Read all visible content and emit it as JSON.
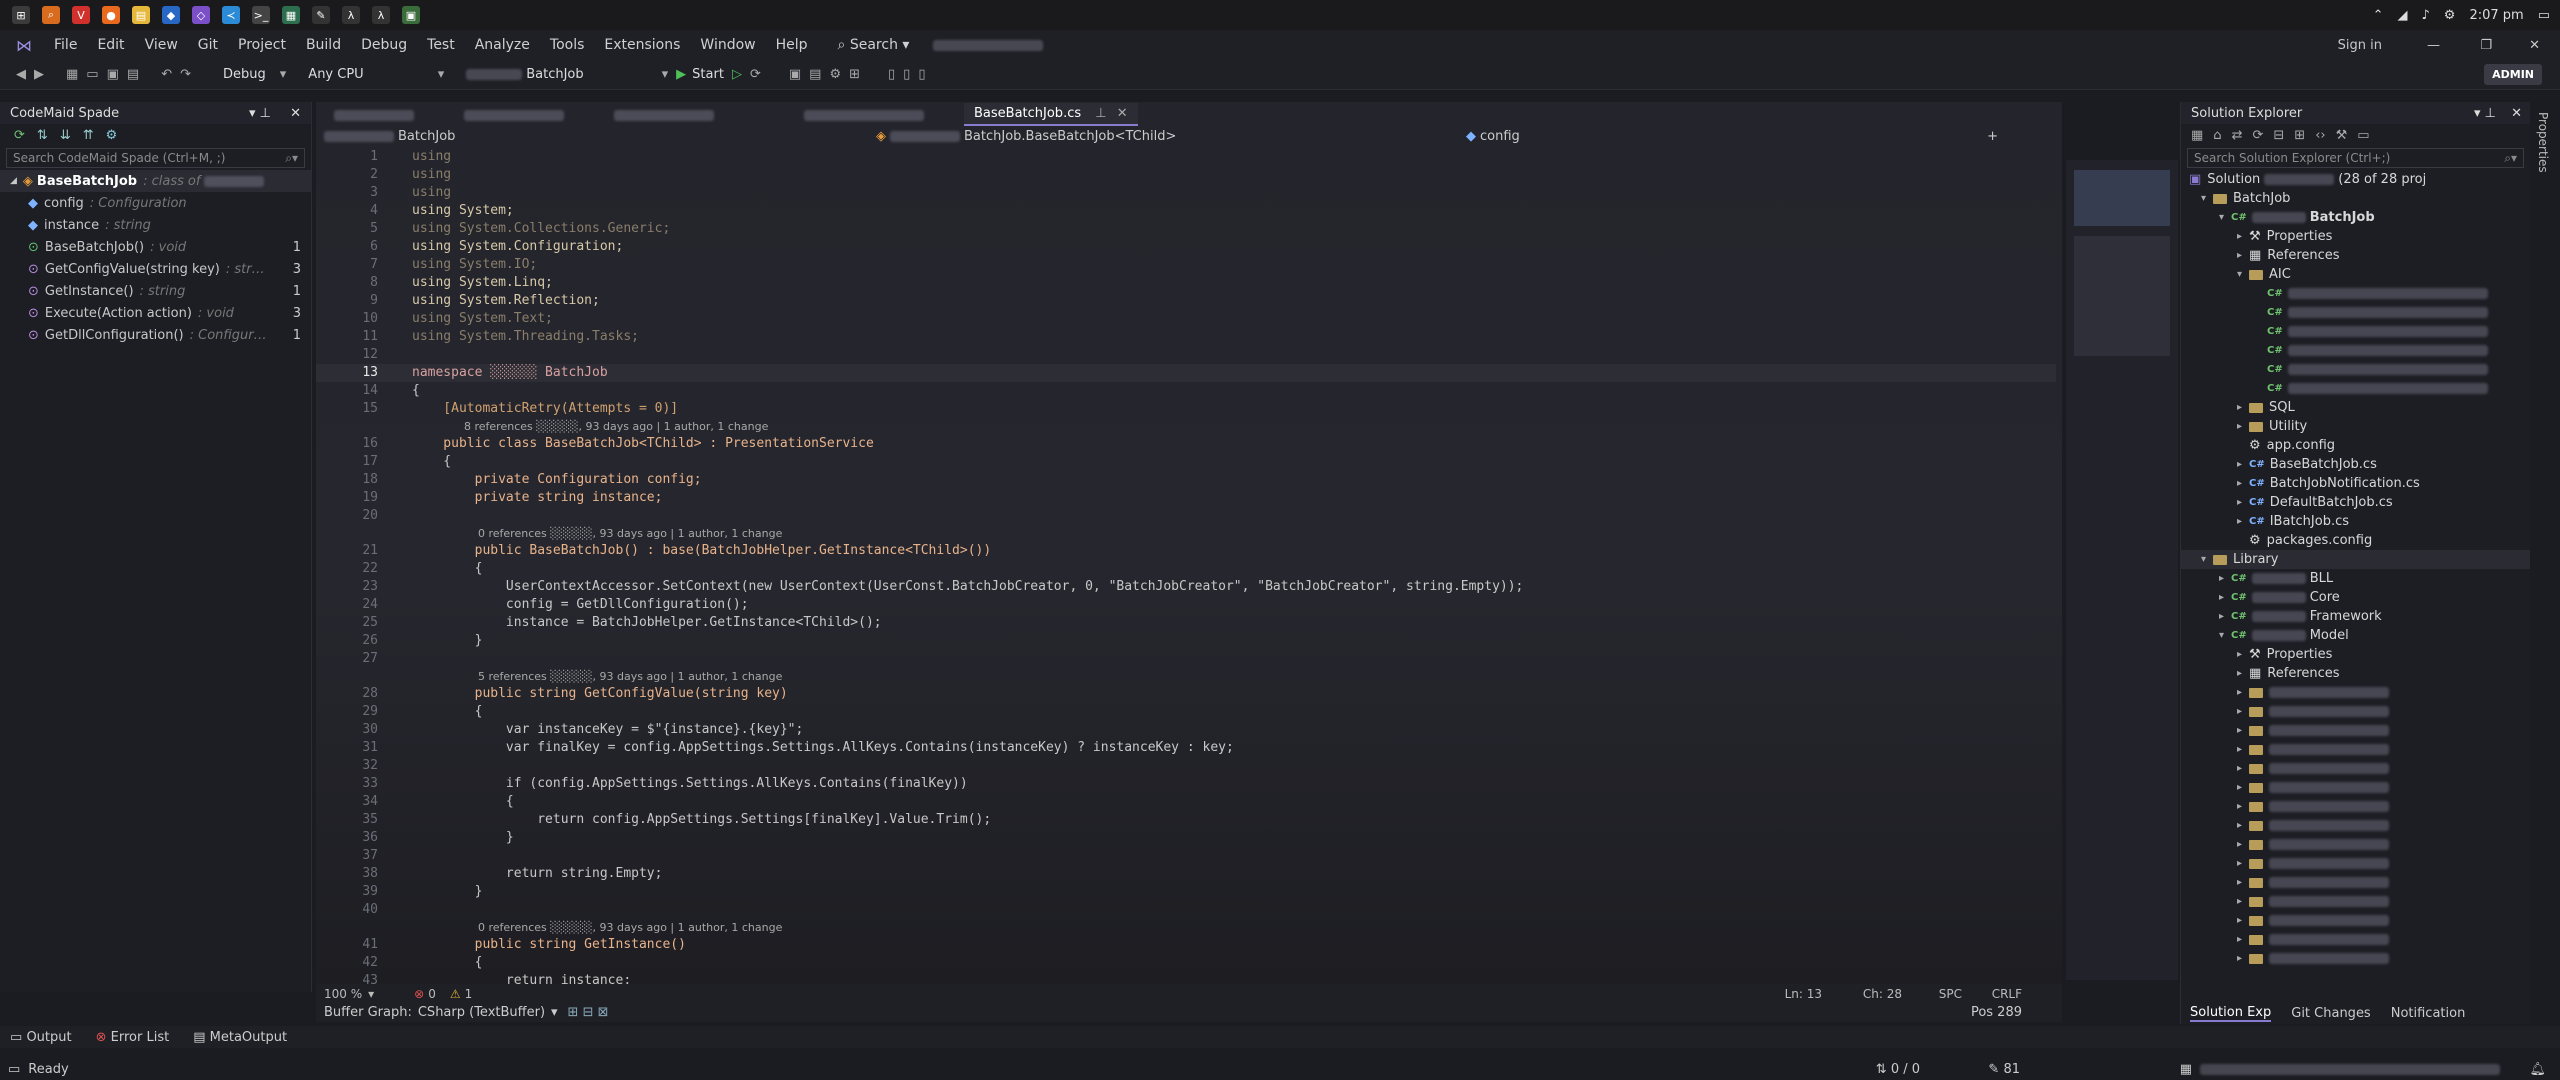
{
  "taskbar": {
    "time": "2:07 pm"
  },
  "menu": {
    "items": [
      "File",
      "Edit",
      "View",
      "Git",
      "Project",
      "Build",
      "Debug",
      "Test",
      "Analyze",
      "Tools",
      "Extensions",
      "Window",
      "Help"
    ],
    "search_label": "Search",
    "sign_in": "Sign in"
  },
  "toolbar": {
    "config": "Debug",
    "platform": "Any CPU",
    "project": "BatchJob",
    "start_label": "Start",
    "admin": "ADMIN"
  },
  "spade": {
    "title": "CodeMaid Spade",
    "search_placeholder": "Search CodeMaid Spade (Ctrl+M, ;)",
    "root_name": "BaseBatchJob",
    "root_kind": ": class",
    "root_of": "of",
    "members": [
      {
        "name": "config",
        "type": ": Configuration",
        "count": ""
      },
      {
        "name": "instance",
        "type": ": string",
        "count": ""
      },
      {
        "name": "BaseBatchJob()",
        "type": ": void",
        "count": "1"
      },
      {
        "name": "GetConfigValue(string key)",
        "type": ": str…",
        "count": "3"
      },
      {
        "name": "GetInstance()",
        "type": ": string",
        "count": "1"
      },
      {
        "name": "Execute(Action action)",
        "type": ": void",
        "count": "3"
      },
      {
        "name": "GetDllConfiguration()",
        "type": ": Configur…",
        "count": "1"
      }
    ]
  },
  "editor": {
    "active_tab": "BaseBatchJob.cs",
    "nav_left": "BatchJob",
    "nav_mid": "BatchJob.BaseBatchJob<TChild>",
    "nav_right": "config",
    "zoom": "100 %",
    "errors": "0",
    "warnings": "1",
    "ln": "Ln: 13",
    "ch": "Ch: 28",
    "spc": "SPC",
    "crlf": "CRLF",
    "buffer_graph": "Buffer Graph:",
    "buffer_value": "CSharp (TextBuffer)",
    "pos": "Pos 289"
  },
  "code_lines": [
    {
      "n": "1",
      "t": "using",
      "dimmed": true
    },
    {
      "n": "2",
      "t": "using",
      "dimmed": true
    },
    {
      "n": "3",
      "t": "using",
      "dimmed": true
    },
    {
      "n": "4",
      "t": "using System;"
    },
    {
      "n": "5",
      "t": "using System.Collections.Generic;",
      "dimmed": true
    },
    {
      "n": "6",
      "t": "using System.Configuration;"
    },
    {
      "n": "7",
      "t": "using System.IO;",
      "dimmed": true
    },
    {
      "n": "8",
      "t": "using System.Linq;"
    },
    {
      "n": "9",
      "t": "using System.Reflection;"
    },
    {
      "n": "10",
      "t": "using System.Text;",
      "dimmed": true
    },
    {
      "n": "11",
      "t": "using System.Threading.Tasks;",
      "dimmed": true
    },
    {
      "n": "12",
      "t": ""
    },
    {
      "n": "13",
      "t": "namespace ░░░░░░ BatchJob"
    },
    {
      "n": "14",
      "t": "{"
    },
    {
      "n": "15",
      "t": "    [AutomaticRetry(Attempts = 0)]"
    },
    {
      "lens": "8 references ░░░░░, 93 days ago | 1 author, 1 change"
    },
    {
      "n": "16",
      "t": "    public class BaseBatchJob<TChild> : PresentationService"
    },
    {
      "n": "17",
      "t": "    {"
    },
    {
      "n": "18",
      "t": "        private Configuration config;"
    },
    {
      "n": "19",
      "t": "        private string instance;"
    },
    {
      "n": "20",
      "t": ""
    },
    {
      "lens": "    0 references ░░░░░, 93 days ago | 1 author, 1 change"
    },
    {
      "n": "21",
      "t": "        public BaseBatchJob() : base(BatchJobHelper.GetInstance<TChild>())"
    },
    {
      "n": "22",
      "t": "        {"
    },
    {
      "n": "23",
      "t": "            UserContextAccessor.SetContext(new UserContext(UserConst.BatchJobCreator, 0, \"BatchJobCreator\", \"BatchJobCreator\", string.Empty));"
    },
    {
      "n": "24",
      "t": "            config = GetDllConfiguration();"
    },
    {
      "n": "25",
      "t": "            instance = BatchJobHelper.GetInstance<TChild>();"
    },
    {
      "n": "26",
      "t": "        }"
    },
    {
      "n": "27",
      "t": ""
    },
    {
      "lens": "    5 references ░░░░░, 93 days ago | 1 author, 1 change"
    },
    {
      "n": "28",
      "t": "        public string GetConfigValue(string key)"
    },
    {
      "n": "29",
      "t": "        {"
    },
    {
      "n": "30",
      "t": "            var instanceKey = $\"{instance}.{key}\";"
    },
    {
      "n": "31",
      "t": "            var finalKey = config.AppSettings.Settings.AllKeys.Contains(instanceKey) ? instanceKey : key;"
    },
    {
      "n": "32",
      "t": ""
    },
    {
      "n": "33",
      "t": "            if (config.AppSettings.Settings.AllKeys.Contains(finalKey))"
    },
    {
      "n": "34",
      "t": "            {"
    },
    {
      "n": "35",
      "t": "                return config.AppSettings.Settings[finalKey].Value.Trim();"
    },
    {
      "n": "36",
      "t": "            }"
    },
    {
      "n": "37",
      "t": ""
    },
    {
      "n": "38",
      "t": "            return string.Empty;"
    },
    {
      "n": "39",
      "t": "        }"
    },
    {
      "n": "40",
      "t": ""
    },
    {
      "lens": "    0 references ░░░░░, 93 days ago | 1 author, 1 change"
    },
    {
      "n": "41",
      "t": "        public string GetInstance()"
    },
    {
      "n": "42",
      "t": "        {"
    },
    {
      "n": "43",
      "t": "            return instance;"
    }
  ],
  "solution": {
    "title": "Solution Explorer",
    "search_placeholder": "Search Solution Explorer (Ctrl+;)",
    "root": "Solution",
    "root_suffix": "(28 of 28 proj",
    "rows": [
      {
        "indent": 0,
        "kind": "folder",
        "label": "BatchJob",
        "arrow": "▾"
      },
      {
        "indent": 1,
        "kind": "proj",
        "label": "BatchJob",
        "arrow": "▾",
        "bold": true
      },
      {
        "indent": 2,
        "kind": "wrench",
        "label": "Properties",
        "arrow": "▸"
      },
      {
        "indent": 2,
        "kind": "refs",
        "label": "References",
        "arrow": "▸"
      },
      {
        "indent": 2,
        "kind": "folder",
        "label": "AIC",
        "arrow": "▾"
      },
      {
        "indent": 3,
        "kind": "blur",
        "label": "",
        "arrow": ""
      },
      {
        "indent": 3,
        "kind": "blur",
        "label": "",
        "arrow": ""
      },
      {
        "indent": 3,
        "kind": "blur",
        "label": "",
        "arrow": ""
      },
      {
        "indent": 3,
        "kind": "blur",
        "label": "",
        "arrow": ""
      },
      {
        "indent": 3,
        "kind": "blur",
        "label": "",
        "arrow": ""
      },
      {
        "indent": 3,
        "kind": "blur",
        "label": "",
        "arrow": ""
      },
      {
        "indent": 2,
        "kind": "folder",
        "label": "SQL",
        "arrow": "▸"
      },
      {
        "indent": 2,
        "kind": "folder",
        "label": "Utility",
        "arrow": "▸"
      },
      {
        "indent": 2,
        "kind": "config",
        "label": "app.config",
        "arrow": ""
      },
      {
        "indent": 2,
        "kind": "cs",
        "label": "BaseBatchJob.cs",
        "arrow": "▸"
      },
      {
        "indent": 2,
        "kind": "cs",
        "label": "BatchJobNotification.cs",
        "arrow": "▸"
      },
      {
        "indent": 2,
        "kind": "cs",
        "label": "DefaultBatchJob.cs",
        "arrow": "▸"
      },
      {
        "indent": 2,
        "kind": "cs",
        "label": "IBatchJob.cs",
        "arrow": "▸"
      },
      {
        "indent": 2,
        "kind": "config",
        "label": "packages.config",
        "arrow": ""
      },
      {
        "indent": 0,
        "kind": "folder",
        "label": "Library",
        "arrow": "▾",
        "selected": true
      },
      {
        "indent": 1,
        "kind": "proj",
        "label": "BLL",
        "arrow": "▸"
      },
      {
        "indent": 1,
        "kind": "proj",
        "label": "Core",
        "arrow": "▸"
      },
      {
        "indent": 1,
        "kind": "proj",
        "label": "Framework",
        "arrow": "▸"
      },
      {
        "indent": 1,
        "kind": "proj",
        "label": "Model",
        "arrow": "▾"
      },
      {
        "indent": 2,
        "kind": "wrench",
        "label": "Properties",
        "arrow": "▸"
      },
      {
        "indent": 2,
        "kind": "refs",
        "label": "References",
        "arrow": "▸"
      },
      {
        "indent": 2,
        "kind": "folderblur",
        "label": "",
        "arrow": "▸"
      },
      {
        "indent": 2,
        "kind": "folderblur",
        "label": "",
        "arrow": "▸"
      },
      {
        "indent": 2,
        "kind": "folderblur",
        "label": "",
        "arrow": "▸"
      },
      {
        "indent": 2,
        "kind": "folderblur",
        "label": "",
        "arrow": "▸"
      },
      {
        "indent": 2,
        "kind": "folderblur",
        "label": "",
        "arrow": "▸"
      },
      {
        "indent": 2,
        "kind": "folderblur",
        "label": "",
        "arrow": "▸"
      },
      {
        "indent": 2,
        "kind": "folderblur",
        "label": "",
        "arrow": "▸"
      },
      {
        "indent": 2,
        "kind": "folderblur",
        "label": "",
        "arrow": "▸"
      },
      {
        "indent": 2,
        "kind": "folderblur",
        "label": "",
        "arrow": "▸"
      },
      {
        "indent": 2,
        "kind": "folderblur",
        "label": "",
        "arrow": "▸"
      },
      {
        "indent": 2,
        "kind": "folderblur",
        "label": "",
        "arrow": "▸"
      },
      {
        "indent": 2,
        "kind": "folderblur",
        "label": "",
        "arrow": "▸"
      },
      {
        "indent": 2,
        "kind": "folderblur",
        "label": "",
        "arrow": "▸"
      },
      {
        "indent": 2,
        "kind": "folderblur",
        "label": "",
        "arrow": "▸"
      },
      {
        "indent": 2,
        "kind": "folderblur",
        "label": "",
        "arrow": "▸"
      }
    ],
    "bottom_tabs": [
      "Solution Exp",
      "Git Changes",
      "Notification"
    ]
  },
  "bottom": {
    "tabs": [
      "Output",
      "Error List",
      "MetaOutput"
    ],
    "status": "Ready",
    "up_down": "0 / 0",
    "pencil_count": "81"
  },
  "right_strip": {
    "label": "Properties"
  }
}
